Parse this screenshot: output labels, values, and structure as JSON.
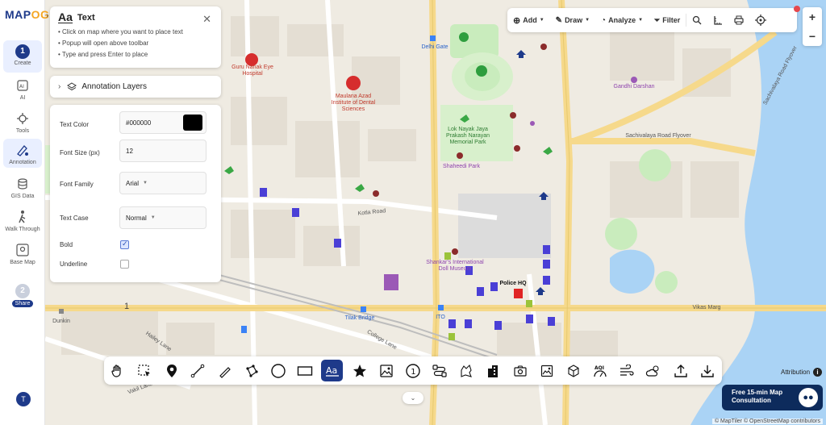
{
  "app": {
    "logo_main": "MAP",
    "logo_accent": "OG"
  },
  "rail": {
    "steps": [
      {
        "number": "1",
        "label": "Create"
      },
      {
        "number": "2",
        "label": "Share"
      }
    ],
    "items": [
      {
        "label": "AI",
        "icon": "ai-icon"
      },
      {
        "label": "Tools",
        "icon": "tools-icon"
      },
      {
        "label": "Annotation",
        "icon": "annotation-icon"
      },
      {
        "label": "GIS Data",
        "icon": "gis-data-icon"
      },
      {
        "label": "Walk Through",
        "icon": "walk-through-icon"
      },
      {
        "label": "Base Map",
        "icon": "base-map-icon"
      }
    ],
    "avatar_initial": "T"
  },
  "text_panel": {
    "title": "Text",
    "hints": [
      "• Click on map where you want to place text",
      "• Popup will open above toolbar",
      "• Type and press Enter to place"
    ]
  },
  "layers_panel": {
    "label": "Annotation Layers"
  },
  "style_panel": {
    "text_color": {
      "label": "Text Color",
      "value": "#000000",
      "swatch": "#000000"
    },
    "font_size": {
      "label": "Font Size (px)",
      "value": "12"
    },
    "font_family": {
      "label": "Font Family",
      "value": "Arial"
    },
    "text_case": {
      "label": "Text Case",
      "value": "Normal"
    },
    "bold": {
      "label": "Bold",
      "checked": true
    },
    "underline": {
      "label": "Underline",
      "checked": false
    }
  },
  "topbar": {
    "add": "Add",
    "draw": "Draw",
    "analyze": "Analyze",
    "filter": "Filter"
  },
  "zoom": {
    "in": "+",
    "out": "−"
  },
  "map_labels": {
    "delhi_gate": "Delhi Gate",
    "guru_nanak": "Guru Nanak Eye Hospital",
    "maulana_azad": "Maulana Azad Institute of Dental Sciences",
    "gandhi_darshan": "Gandhi Darshan",
    "lok_nayak": "Lok Nayak Jaya Prakash Narayan Memorial Park",
    "shaheedi_park": "Shaheedi Park",
    "sachivalaya_flyover": "Sachivalaya Road Flyover",
    "sachivalaya_road_flyover": "Sachivalaya Road Flyover",
    "kotla_road": "Kotla Road",
    "shankars": "Shankar's International Doll Museum",
    "police_hq": "Police HQ",
    "vikas_marg": "Vikas Marg",
    "tilak_bridge": "Tilak Bridge",
    "ito": "ITO",
    "college_lane": "College Lane",
    "hailey_lane": "Hailey Lane",
    "dunkin": "Dunkin",
    "vakil_lane": "Vakil Lane",
    "placed_text": "1"
  },
  "bottom_tools": [
    "pan-hand-icon",
    "select-icon",
    "marker-icon",
    "line-icon",
    "freehand-icon",
    "polygon-icon",
    "circle-icon",
    "rectangle-icon",
    "text-icon",
    "star-icon",
    "image-icon",
    "number-icon",
    "route-icon",
    "shape-icon",
    "building-icon",
    "camera-icon",
    "photo-icon",
    "3d-box-icon",
    "aqi-icon",
    "wind-icon",
    "weather-icon",
    "upload-icon",
    "download-icon"
  ],
  "attribution": {
    "label": "Attribution",
    "info": "i"
  },
  "consult": {
    "line1": "Free 15-min Map",
    "line2": "Consultation"
  },
  "credits": "© MapTiler © OpenStreetMap contributors",
  "colors": {
    "brand": "#1e3a8a",
    "accent": "#f5a623",
    "river": "#aad3f5",
    "park": "#c9ecbd",
    "road_major": "#f6d98b"
  }
}
